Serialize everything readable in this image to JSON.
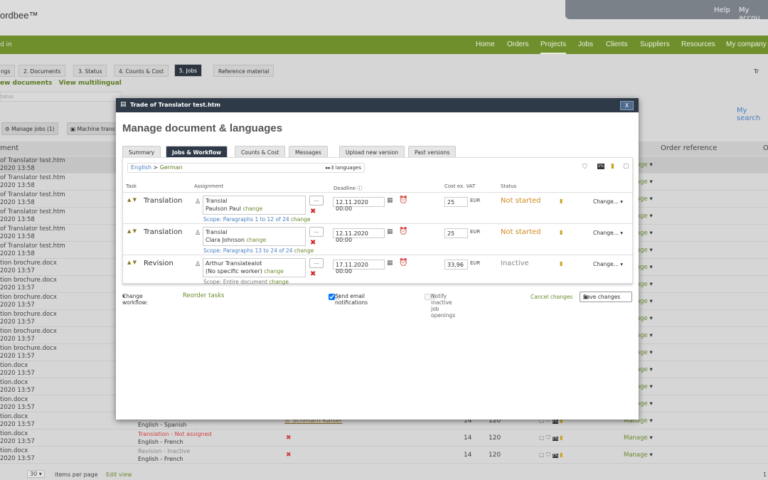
{
  "header": {
    "logo": "ordbee™",
    "help": "Help",
    "account": "My accou"
  },
  "nav": {
    "left": "d in",
    "items": [
      "Home",
      "Orders",
      "Projects",
      "Jobs",
      "Clients",
      "Suppliers",
      "Resources",
      "My company"
    ],
    "active": "Projects"
  },
  "project_tabs": [
    "ngs",
    "2. Documents",
    "3. Status",
    "4. Counts & Cost",
    "5. Jobs",
    "Reference material"
  ],
  "project_tabs_right": "Tr",
  "links": [
    "ew documents",
    "View multilingual"
  ],
  "status_filter": "tatus",
  "toolbar": {
    "manage_jobs": "Manage jobs (1)",
    "machine": "Machine trans",
    "my_search": "My search"
  },
  "table": {
    "headers": {
      "document": "ment",
      "order_ref": "Order reference",
      "other": "O"
    },
    "rows": [
      {
        "doc": "of Translator test.htm",
        "date": "2020 13:58",
        "manage": "Manage"
      },
      {
        "doc": "of Translator test.htm",
        "date": "2020 13:58",
        "manage": "Manage"
      },
      {
        "doc": "of Translator test.htm",
        "date": "2020 13:58",
        "manage": "Manage"
      },
      {
        "doc": "of Translator test.htm",
        "date": "2020 13:58",
        "manage": "Manage"
      },
      {
        "doc": "of Translator test.htm",
        "date": "2020 13:58",
        "manage": "Manage"
      },
      {
        "doc": "of Translator test.htm",
        "date": "2020 13:58",
        "manage": "Manage"
      },
      {
        "doc": "tion brochure.docx",
        "date": "2020 13:57",
        "manage": "Manage"
      },
      {
        "doc": "tion brochure.docx",
        "date": "2020 13:57",
        "manage": "Manage"
      },
      {
        "doc": "tion brochure.docx",
        "date": "2020 13:57",
        "manage": "Manage"
      },
      {
        "doc": "tion brochure.docx",
        "date": "2020 13:57",
        "manage": "Manage"
      },
      {
        "doc": "tion brochure.docx",
        "date": "2020 13:57",
        "manage": "Manage"
      },
      {
        "doc": "tion brochure.docx",
        "date": "2020 13:57",
        "manage": "Manage"
      },
      {
        "doc": "tion.docx",
        "date": "2020 13:57",
        "manage": "Manage"
      },
      {
        "doc": "tion.docx",
        "date": "2020 13:57",
        "manage": "Manage"
      },
      {
        "doc": "tion.docx",
        "date": "2020 13:57",
        "manage": "Manage"
      },
      {
        "doc": "tion.docx",
        "date": "2020 13:57",
        "manage": "Manage",
        "task": "",
        "lang": "English - Spanish",
        "assignee": "Schmarn Kaiser",
        "n1": "14",
        "n2": "120"
      },
      {
        "doc": "tion.docx",
        "date": "2020 13:57",
        "manage": "Manage",
        "task": "Translation - Not assigned",
        "lang": "English - French",
        "n1": "14",
        "n2": "120"
      },
      {
        "doc": "tion.docx",
        "date": "2020 13:57",
        "manage": "Manage",
        "task": "Revision - Inactive",
        "lang": "English - French",
        "n1": "14",
        "n2": "120"
      }
    ]
  },
  "footer": {
    "per_page": "30",
    "per_page_label": "items per page",
    "edit_view": "Edit view",
    "page": "1"
  },
  "modal": {
    "title": "Trade of Translator test.htm",
    "close": "X",
    "heading": "Manage document & languages",
    "tabs": [
      "Summary",
      "Jobs & Workflow",
      "Counts & Cost",
      "Messages",
      "Upload new version",
      "Past versions"
    ],
    "active_tab": "Jobs & Workflow",
    "source_lang": "English",
    "target_lang": "German",
    "languages": "3 languages",
    "columns": {
      "task": "Task",
      "assignment": "Assignment",
      "deadline": "Deadline",
      "cost": "Cost ex. VAT",
      "status": "Status"
    },
    "jobs": [
      {
        "task": "Translation",
        "line1": "Translal",
        "line2": "Paulson Paul",
        "change": "change",
        "scope": "Scope: Paragraphs 1 to 12 of 24",
        "scope_change": "change",
        "deadline": "12.11.2020 00:00",
        "cost": "25",
        "currency": "EUR",
        "status": "Not started",
        "status_color": "#d08a1c",
        "action": "Change..."
      },
      {
        "task": "Translation",
        "line1": "Translal",
        "line2": "Clara Johnson",
        "change": "change",
        "scope": "Scope: Paragraphs 13 to 24 of 24",
        "scope_change": "change",
        "deadline": "12.11.2020 00:00",
        "cost": "25",
        "currency": "EUR",
        "status": "Not started",
        "status_color": "#d08a1c",
        "action": "Change..."
      },
      {
        "task": "Revision",
        "line1": "Arthur Translatealot",
        "line2": "(No specific worker)",
        "change": "change",
        "scope": "Scope: Entire document",
        "scope_change": "change",
        "deadline": "17.11.2020 00:00",
        "cost": "33,96",
        "currency": "EUR",
        "status": "Inactive",
        "status_color": "#888888",
        "action": "Change..."
      }
    ],
    "footer": {
      "change_workflow": "Change workflow:",
      "reorder": "Reorder tasks",
      "send_email": "Send email notifications",
      "send_email_checked": true,
      "notify_inactive": "Notify inactive job openings",
      "notify_checked": false,
      "cancel": "Cancel changes",
      "save": "Save changes"
    }
  },
  "colors": {
    "brand_green": "#6f8f2d",
    "modal_title": "#2e3a47",
    "link_blue": "#4a7fc1"
  }
}
